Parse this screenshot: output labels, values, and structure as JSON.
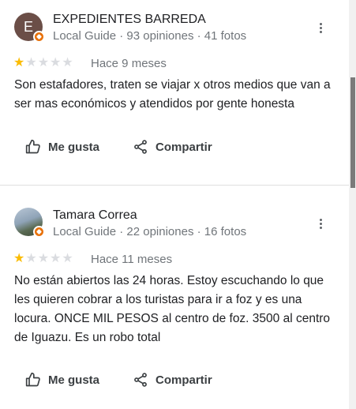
{
  "reviews": [
    {
      "avatar_letter": "E",
      "name": "EXPEDIENTES BARREDA",
      "meta": "Local Guide · 93 opiniones · 41 fotos",
      "rating": 1,
      "max_rating": 5,
      "when": "Hace 9 meses",
      "text": "Son estafadores, traten se viajar x otros medios que van a ser mas económicos y atendidos por gente honesta",
      "like_label": "Me gusta",
      "share_label": "Compartir"
    },
    {
      "avatar_letter": "",
      "name": "Tamara Correa",
      "meta": "Local Guide · 22 opiniones · 16 fotos",
      "rating": 1,
      "max_rating": 5,
      "when": "Hace 11 meses",
      "text": "No están abiertos las 24 horas. Estoy escuchando lo que les quieren cobrar a los turistas para ir a foz y es una locura. ONCE MIL PESOS al centro de foz. 3500 al centro de Iguazu. Es un robo total",
      "like_label": "Me gusta",
      "share_label": "Compartir"
    }
  ],
  "colors": {
    "star_on": "#fbbc04",
    "star_off": "#dadce0",
    "badge": "#e8710a"
  },
  "icons": {
    "like": "thumbs-up-icon",
    "share": "share-icon",
    "menu": "more-vert-icon",
    "guide": "local-guide-badge-icon"
  }
}
